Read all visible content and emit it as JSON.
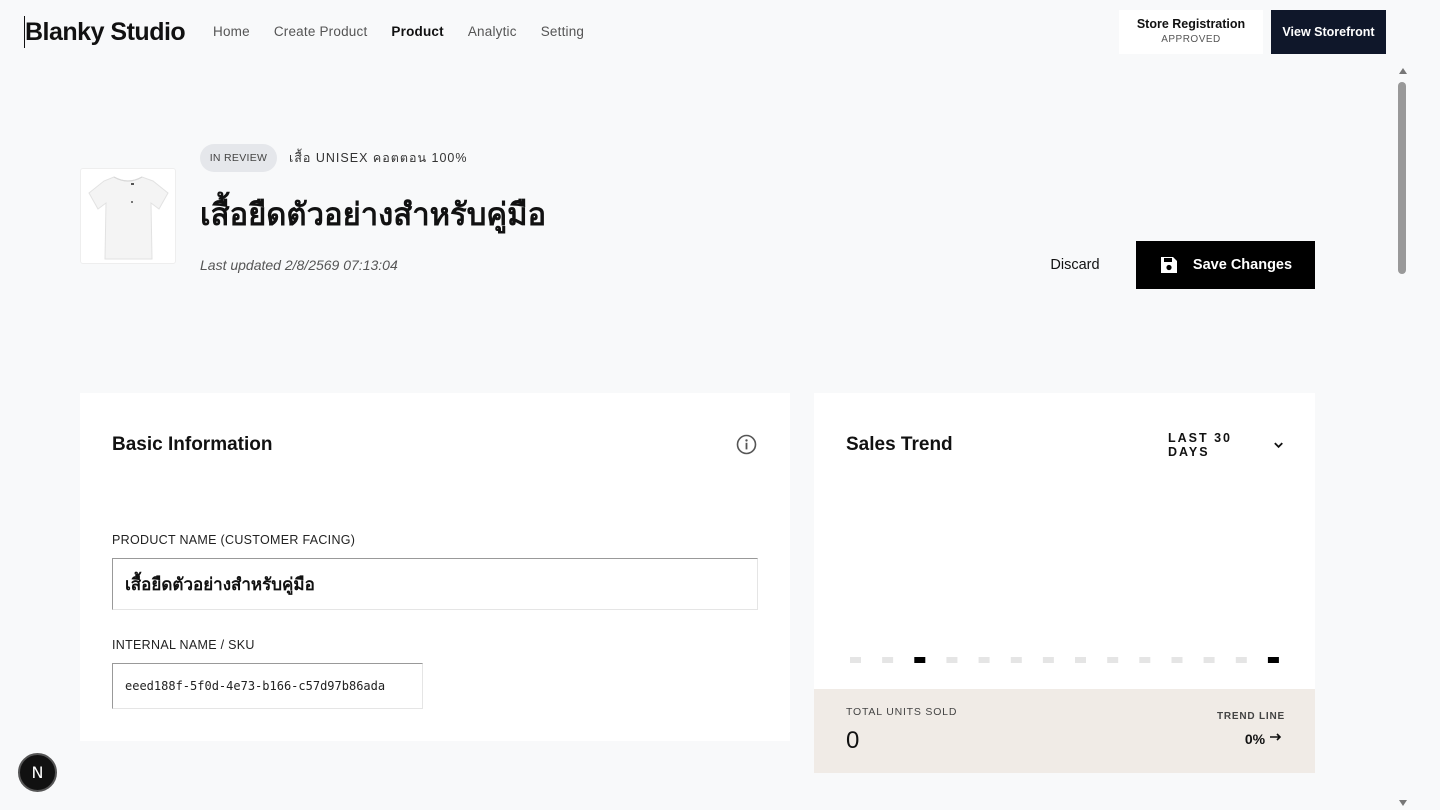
{
  "header": {
    "brand": "Blanky Studio",
    "nav": [
      "Home",
      "Create Product",
      "Product",
      "Analytic",
      "Setting"
    ],
    "active_nav": "Product",
    "store_registration": {
      "title": "Store Registration",
      "status": "APPROVED"
    },
    "view_storefront_label": "View Storefront"
  },
  "product": {
    "status_badge": "IN REVIEW",
    "category": "เสื้อ UNISEX คอตตอน 100%",
    "title": "เสื้อยืดตัวอย่างสำหรับคู่มือ",
    "last_updated": "Last updated 2/8/2569 07:13:04",
    "image_icon": "tshirt-icon"
  },
  "actions": {
    "discard_label": "Discard",
    "save_label": "Save Changes",
    "save_icon": "floppy-disk-icon"
  },
  "basic_info": {
    "title": "Basic Information",
    "info_icon": "info-icon",
    "product_name_label": "PRODUCT NAME (CUSTOMER FACING)",
    "product_name_value": "เสื้อยืดตัวอย่างสำหรับคู่มือ",
    "sku_label": "INTERNAL NAME / SKU",
    "sku_value": "eeed188f-5f0d-4e73-b166-c57d97b86ada"
  },
  "sales_trend": {
    "title": "Sales Trend",
    "range": "LAST 30 DAYS",
    "range_icon": "chevron-down-icon",
    "total_units_label": "TOTAL UNITS SOLD",
    "total_units_value": "0",
    "trend_line_label": "TREND LINE",
    "trend_line_value": "0%",
    "trend_icon": "arrow-right-icon"
  },
  "chart_data": {
    "type": "bar",
    "categories": [
      "",
      "",
      "",
      "",
      "",
      "",
      "",
      "",
      "",
      "",
      "",
      "",
      "",
      ""
    ],
    "values": [
      0,
      0,
      0,
      0,
      0,
      0,
      0,
      0,
      0,
      0,
      0,
      0,
      0,
      0
    ],
    "highlighted": [
      false,
      false,
      true,
      false,
      false,
      false,
      false,
      false,
      false,
      false,
      false,
      false,
      false,
      true
    ],
    "title": "",
    "xlabel": "",
    "ylabel": "",
    "colors": {
      "bar": "#e5e5e5",
      "highlight": "#000000"
    }
  },
  "colors": {
    "primary": "#000000",
    "storefront_button": "#0f172a",
    "background": "#f8f9fa",
    "badge_bg": "#e5e7eb",
    "footer_bg": "#f0ebe6"
  }
}
